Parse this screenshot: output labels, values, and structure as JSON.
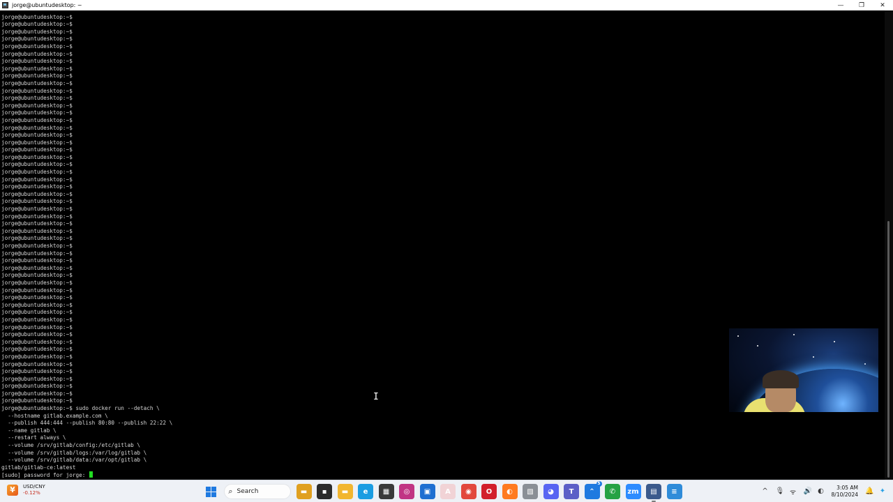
{
  "window": {
    "title": "jorge@ubuntudesktop: ~",
    "minimize_glyph": "—",
    "maximize_glyph": "❐",
    "close_glyph": "✕"
  },
  "terminal": {
    "prompt": "jorge@ubuntudesktop:~$",
    "empty_prompt_count": 53,
    "command_lines": [
      "jorge@ubuntudesktop:~$ sudo docker run --detach \\",
      "  --hostname gitlab.example.com \\",
      "  --publish 444:444 --publish 80:80 --publish 22:22 \\",
      "  --name gitlab \\",
      "  --restart always \\",
      "  --volume /srv/gitlab/config:/etc/gitlab \\",
      "  --volume /srv/gitlab/logs:/var/log/gitlab \\",
      "  --volume /srv/gitlab/data:/var/opt/gitlab \\",
      "gitlab/gitlab-ce:latest"
    ],
    "sudo_prompt": "[sudo] password for jorge: ",
    "cursor_color": "#22dd22"
  },
  "taskbar": {
    "widget": {
      "label": "USD/CNY",
      "change": "-0.12%",
      "change_color": "#c42b1c"
    },
    "search_placeholder": "Search",
    "apps": [
      {
        "name": "file-explorer-folder-icon",
        "glyph": "▬",
        "color": "#e0a020",
        "active": false
      },
      {
        "name": "task-view-icon",
        "glyph": "▪",
        "color": "#2b2b2b",
        "active": false
      },
      {
        "name": "file-explorer-icon",
        "glyph": "▬",
        "color": "#f2b630",
        "active": false
      },
      {
        "name": "edge-icon",
        "glyph": "e",
        "color": "#1b9de2",
        "active": false
      },
      {
        "name": "calculator-icon",
        "glyph": "▦",
        "color": "#3a3a3a",
        "active": false
      },
      {
        "name": "instagram-icon",
        "glyph": "◎",
        "color": "#c13584",
        "active": false
      },
      {
        "name": "store-icon",
        "glyph": "▣",
        "color": "#1f6fd1",
        "active": false
      },
      {
        "name": "acrobat-icon",
        "glyph": "A",
        "color": "#f1d3d6",
        "active": false
      },
      {
        "name": "chrome-icon",
        "glyph": "◉",
        "color": "#e2483d",
        "active": false
      },
      {
        "name": "opera-icon",
        "glyph": "O",
        "color": "#d21f2b",
        "active": false
      },
      {
        "name": "firefox-icon",
        "glyph": "◐",
        "color": "#ff7a1f",
        "active": false
      },
      {
        "name": "image-viewer-icon",
        "glyph": "▧",
        "color": "#8a8f96",
        "active": false
      },
      {
        "name": "discord-icon",
        "glyph": "◕",
        "color": "#5865f2",
        "active": false
      },
      {
        "name": "teams-icon",
        "glyph": "T",
        "color": "#5b5fc7",
        "active": false
      },
      {
        "name": "remote-desktop-icon",
        "glyph": "⌃",
        "color": "#1f7ae0",
        "active": false
      },
      {
        "name": "whatsapp-icon",
        "glyph": "✆",
        "color": "#25a244",
        "active": false
      },
      {
        "name": "zoom-icon",
        "glyph": "zm",
        "color": "#2d8cff",
        "active": false
      },
      {
        "name": "putty-icon",
        "glyph": "▤",
        "color": "#3b5a8c",
        "active": true
      },
      {
        "name": "notepad-icon",
        "glyph": "≡",
        "color": "#2f8cd9",
        "active": false
      }
    ],
    "badges": {
      "teams": "",
      "remote": "5"
    },
    "clock": {
      "time": "3:05 AM",
      "date": "8/10/2024"
    },
    "tray": {
      "chevron": "^",
      "mic": "🎙",
      "wifi": "ᯤ",
      "volume": "🔊",
      "battery": "◐",
      "bell": "🔔"
    }
  }
}
